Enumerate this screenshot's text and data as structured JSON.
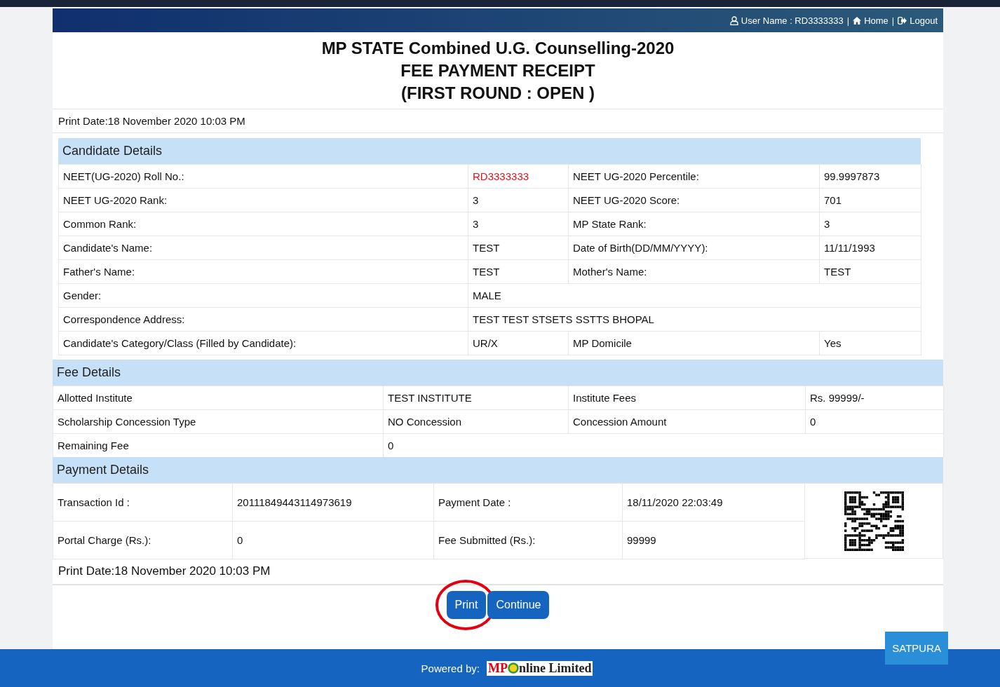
{
  "header": {
    "user_label": "User Name : RD3333333",
    "separator": "|",
    "home": "Home",
    "logout": "Logout"
  },
  "titles": [
    "MP STATE Combined U.G. Counselling-2020",
    "FEE PAYMENT RECEIPT",
    "(FIRST ROUND : OPEN )"
  ],
  "print_date_top": "Print Date:18 November 2020 10:03 PM",
  "candidate": {
    "heading": "Candidate Details",
    "rows": [
      {
        "cells": [
          {
            "text": "NEET(UG-2020) Roll No.:"
          },
          {
            "text": "RD3333333",
            "color": "#e8101a"
          },
          {
            "text": "NEET UG-2020 Percentile:"
          },
          {
            "text": "99.9997873"
          }
        ]
      },
      {
        "cells": [
          {
            "text": "NEET UG-2020 Rank:"
          },
          {
            "text": "3"
          },
          {
            "text": "NEET UG-2020 Score:"
          },
          {
            "text": "701"
          }
        ]
      },
      {
        "cells": [
          {
            "text": "Common Rank:"
          },
          {
            "text": "3"
          },
          {
            "text": "MP State Rank:"
          },
          {
            "text": "3"
          }
        ]
      },
      {
        "cells": [
          {
            "text": "Candidate's Name:"
          },
          {
            "text": "TEST"
          },
          {
            "text": "Date of Birth(DD/MM/YYYY):"
          },
          {
            "text": "11/11/1993"
          }
        ]
      },
      {
        "cells": [
          {
            "text": "Father's Name:"
          },
          {
            "text": "TEST"
          },
          {
            "text": "Mother's Name:"
          },
          {
            "text": "TEST"
          }
        ]
      },
      {
        "cells": [
          {
            "text": "Gender:"
          },
          {
            "text": "MALE"
          }
        ]
      },
      {
        "cells": [
          {
            "text": "Correspondence Address:"
          },
          {
            "text": "TEST TEST STSETS SSTTS BHOPAL"
          }
        ]
      },
      {
        "cells": [
          {
            "text": "Candidate's Category/Class (Filled by Candidate):"
          },
          {
            "text": "UR/X"
          },
          {
            "text": "MP Domicile"
          },
          {
            "text": "Yes"
          }
        ]
      }
    ]
  },
  "fee": {
    "heading": "Fee Details",
    "rows": [
      {
        "cells": [
          {
            "text": "Allotted Institute"
          },
          {
            "text": "TEST INSTITUTE"
          },
          {
            "text": "Institute Fees"
          },
          {
            "text": "Rs. 99999/-"
          }
        ]
      },
      {
        "cells": [
          {
            "text": "Scholarship Concession Type"
          },
          {
            "text": "NO Concession"
          },
          {
            "text": "Concession Amount"
          },
          {
            "text": "0"
          }
        ]
      },
      {
        "cells": [
          {
            "text": "Remaining Fee"
          },
          {
            "text": "0"
          }
        ]
      }
    ]
  },
  "payment": {
    "heading": "Payment Details",
    "rows": [
      {
        "cells": [
          {
            "text": "Transaction Id :"
          },
          {
            "text": "20111849443114973619"
          },
          {
            "text": "Payment Date :"
          },
          {
            "text": "18/11/2020 22:03:49"
          }
        ]
      },
      {
        "cells": [
          {
            "text": "Portal Charge (Rs.):"
          },
          {
            "text": "0"
          },
          {
            "text": "Fee Submitted (Rs.):"
          },
          {
            "text": "99999"
          }
        ]
      }
    ]
  },
  "print_date_bottom": "Print Date:18 November 2020 10:03 PM",
  "buttons": [
    {
      "label": "Print",
      "circled": true
    },
    {
      "label": "Continue",
      "circled": false
    }
  ],
  "badge": "SATPURA",
  "footer": {
    "powered_by": "Powered by:",
    "logo_prefix": "MP",
    "logo_suffix": "nline Limited"
  }
}
